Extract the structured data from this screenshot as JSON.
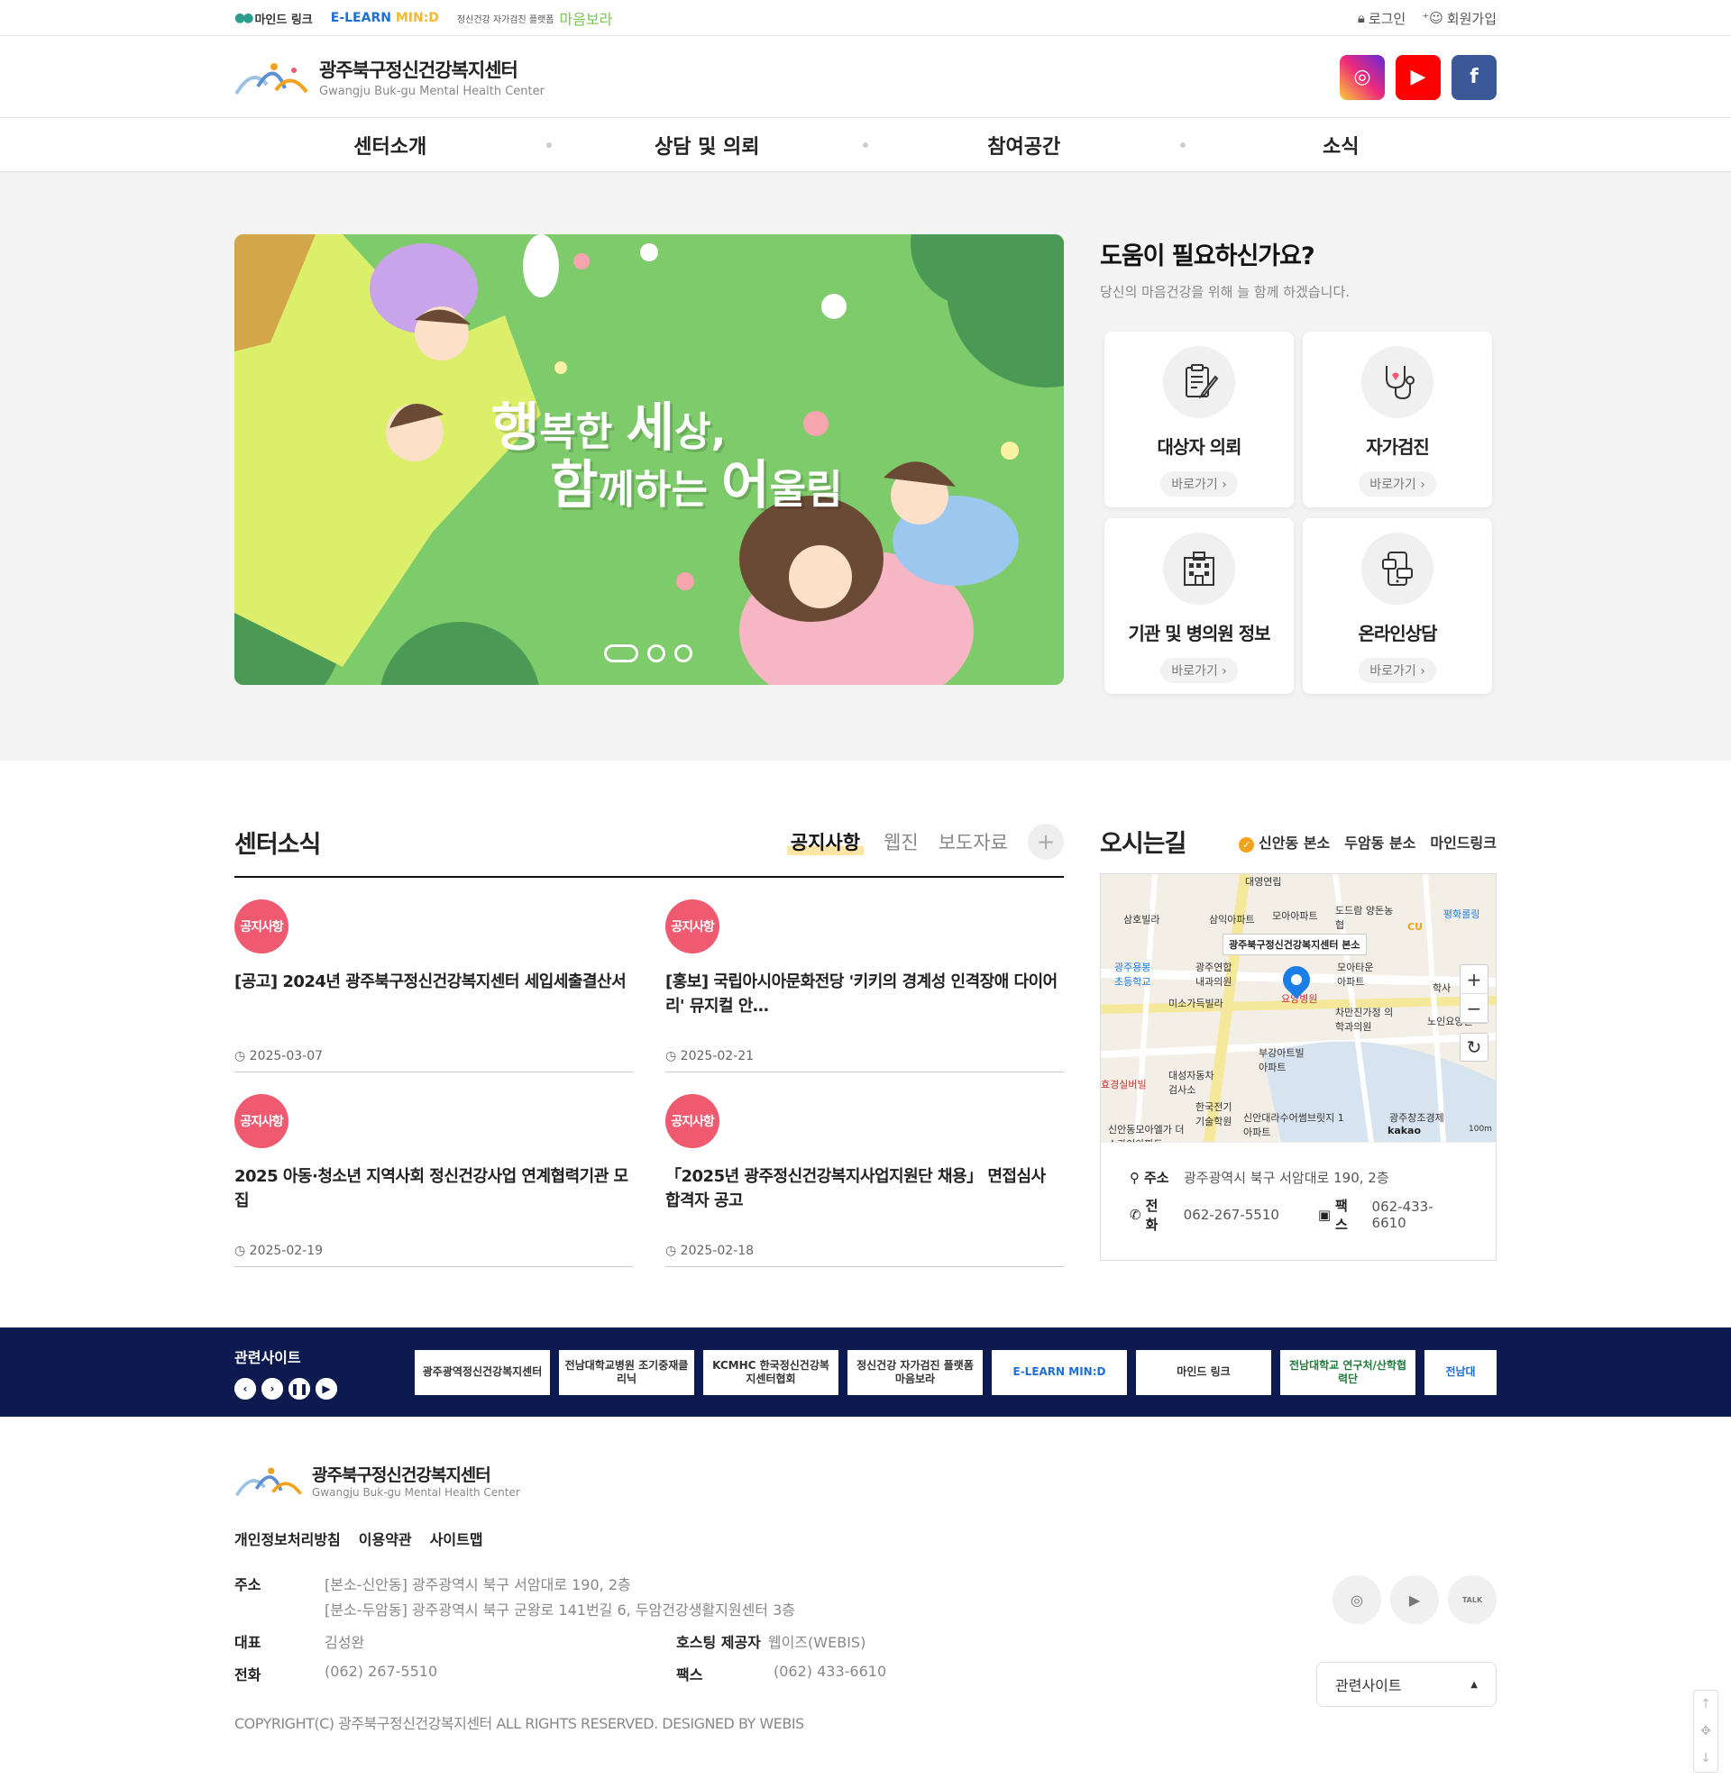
{
  "topbar": {
    "mindlink": "마인드 링크",
    "elearn_a": "E-LEARN",
    "elearn_b": "MIN:D",
    "maum_prefix": "정신건강 자가검진 플랫폼",
    "maum_name": "마음보라",
    "login": "로그인",
    "join": "회원가입"
  },
  "header": {
    "name": "광주북구정신건강복지센터",
    "name_en": "Gwangju Buk-gu Mental Health Center"
  },
  "gnb": [
    "센터소개",
    "상담 및 의뢰",
    "참여공간",
    "소식"
  ],
  "banner": {
    "line1_a": "행",
    "line1_b": "복한 ",
    "line1_c": "세",
    "line1_d": "상,",
    "line2_a": "함",
    "line2_b": "께하는 ",
    "line2_c": "어",
    "line2_d": "울림"
  },
  "help": {
    "title": "도움이 필요하신가요?",
    "subtitle": "당신의 마음건강을 위해 늘 함께 하겠습니다.",
    "go_label": "바로가기",
    "cards": [
      {
        "label": "대상자 의뢰",
        "icon": "clipboard-pen-icon"
      },
      {
        "label": "자가검진",
        "icon": "stethoscope-icon"
      },
      {
        "label": "기관 및 병의원 정보",
        "icon": "building-icon"
      },
      {
        "label": "온라인상담",
        "icon": "phone-chat-icon"
      }
    ]
  },
  "news": {
    "title": "센터소식",
    "tabs": [
      "공지사항",
      "웹진",
      "보도자료"
    ],
    "posts": [
      {
        "badge": "공지사항",
        "title": "[공고] 2024년 광주북구정신건강복지센터 세입세출결산서",
        "date": "2025-03-07"
      },
      {
        "badge": "공지사항",
        "title": "[홍보] 국립아시아문화전당 '키키의 경계성 인격장애 다이어리' 뮤지컬 안…",
        "date": "2025-02-21"
      },
      {
        "badge": "공지사항",
        "title": "2025 아동·청소년 지역사회 정신건강사업 연계협력기관 모집",
        "date": "2025-02-19"
      },
      {
        "badge": "공지사항",
        "title": "「2025년 광주정신건강복지사업지원단 채용」 면접심사 합격자 공고",
        "date": "2025-02-18"
      }
    ]
  },
  "map": {
    "title": "오시는길",
    "tabs": [
      "신안동 본소",
      "두암동 분소",
      "마인드링크"
    ],
    "center_label": "광주북구정신건강복지센터 본소",
    "labels": [
      "대영연립",
      "삼익아파트",
      "모아아파트",
      "도드람 양돈농협",
      "평화롤링",
      "삼호빌라",
      "광주용봉 초등학교",
      "광주연합 내과의원",
      "모아타운 아파트",
      "미소가득빌라",
      "차만진가정 의학과의원",
      "부강아트빌 아파트",
      "대성자동차 검사소",
      "효경실버빌",
      "한국전기 기술학원",
      "신안대라수어썸브릿지 1아파트",
      "신안동모아엘가 더스카이아파트",
      "광주창조경제",
      "요양병원",
      "학사",
      "노인요양원",
      "CU"
    ],
    "scale": "100m",
    "kakao": "kakao",
    "address_label": "주소",
    "address": "광주광역시 북구 서암대로 190, 2층",
    "tel_label": "전화",
    "tel": "062-267-5510",
    "fax_label": "팩스",
    "fax": "062-433-6610"
  },
  "related": {
    "title": "관련사이트",
    "sites": [
      "광주광역정신건강복지센터",
      "전남대학교병원 조기중재클리닉",
      "KCMHC 한국정신건강복지센터협회",
      "정신건강 자가검진 플랫폼 마음보라",
      "E-LEARN MIN:D",
      "마인드 링크",
      "전남대학교 연구처/산학협력단",
      "전남대"
    ]
  },
  "footer": {
    "name": "광주북구정신건강복지센터",
    "name_en": "Gwangju Buk-gu Mental Health Center",
    "menu": [
      "개인정보처리방침",
      "이용약관",
      "사이트맵"
    ],
    "addr_label": "주소",
    "addr1": "[본소-신안동] 광주광역시 북구 서암대로 190, 2층",
    "addr2": "[분소-두암동] 광주광역시 북구 군왕로 141번길 6, 두암건강생활지원센터 3층",
    "rep_label": "대표",
    "rep": "김성완",
    "host_label": "호스팅 제공자",
    "host": "웹이즈(WEBIS)",
    "tel_label": "전화",
    "tel": "(062) 267-5510",
    "fax_label": "팩스",
    "fax": "(062) 433-6610",
    "copyright": "COPYRIGHT(C) 광주북구정신건강복지센터 ALL RIGHTS RESERVED. DESIGNED BY WEBIS",
    "related_select": "관련사이트",
    "talk": "TALK"
  },
  "colors": {
    "navy": "#0d1a4f",
    "badge": "#f05a70",
    "accent": "#f4a21b"
  }
}
